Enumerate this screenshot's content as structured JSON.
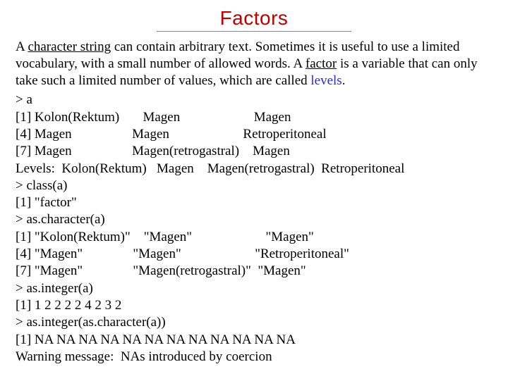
{
  "title": "Factors",
  "para": {
    "seg1": "A ",
    "seg2": "character string",
    "seg3": " can contain arbitrary text. Sometimes it is useful to use a limited vocabulary, with a small number of allowed words. A ",
    "seg4": "factor",
    "seg5": " is a variable that can only take such a limited number of values, which are called ",
    "seg6": "levels",
    "seg7": "."
  },
  "code": {
    "l01": "> a",
    "l02": "[1] Kolon(Rektum)       Magen                      Magen",
    "l03": "[4] Magen                  Magen                      Retroperitoneal",
    "l04": "[7] Magen                  Magen(retrogastral)    Magen",
    "l05": "Levels:  Kolon(Rektum)   Magen    Magen(retrogastral)  Retroperitoneal",
    "l06": "> class(a)",
    "l07": "[1] \"factor\"",
    "l08": "> as.character(a)",
    "l09": "[1] \"Kolon(Rektum)\"    \"Magen\"                      \"Magen\"",
    "l10": "[4] \"Magen\"               \"Magen\"                      \"Retroperitoneal\"",
    "l11": "[7] \"Magen\"               \"Magen(retrogastral)\"  \"Magen\"",
    "l12": "> as.integer(a)",
    "l13": "[1] 1 2 2 2 2 4 2 3 2",
    "l14": "> as.integer(as.character(a))",
    "l15": "[1] NA NA NA NA NA NA NA NA NA NA NA NA",
    "l16": "Warning message:  NAs introduced by coercion"
  }
}
